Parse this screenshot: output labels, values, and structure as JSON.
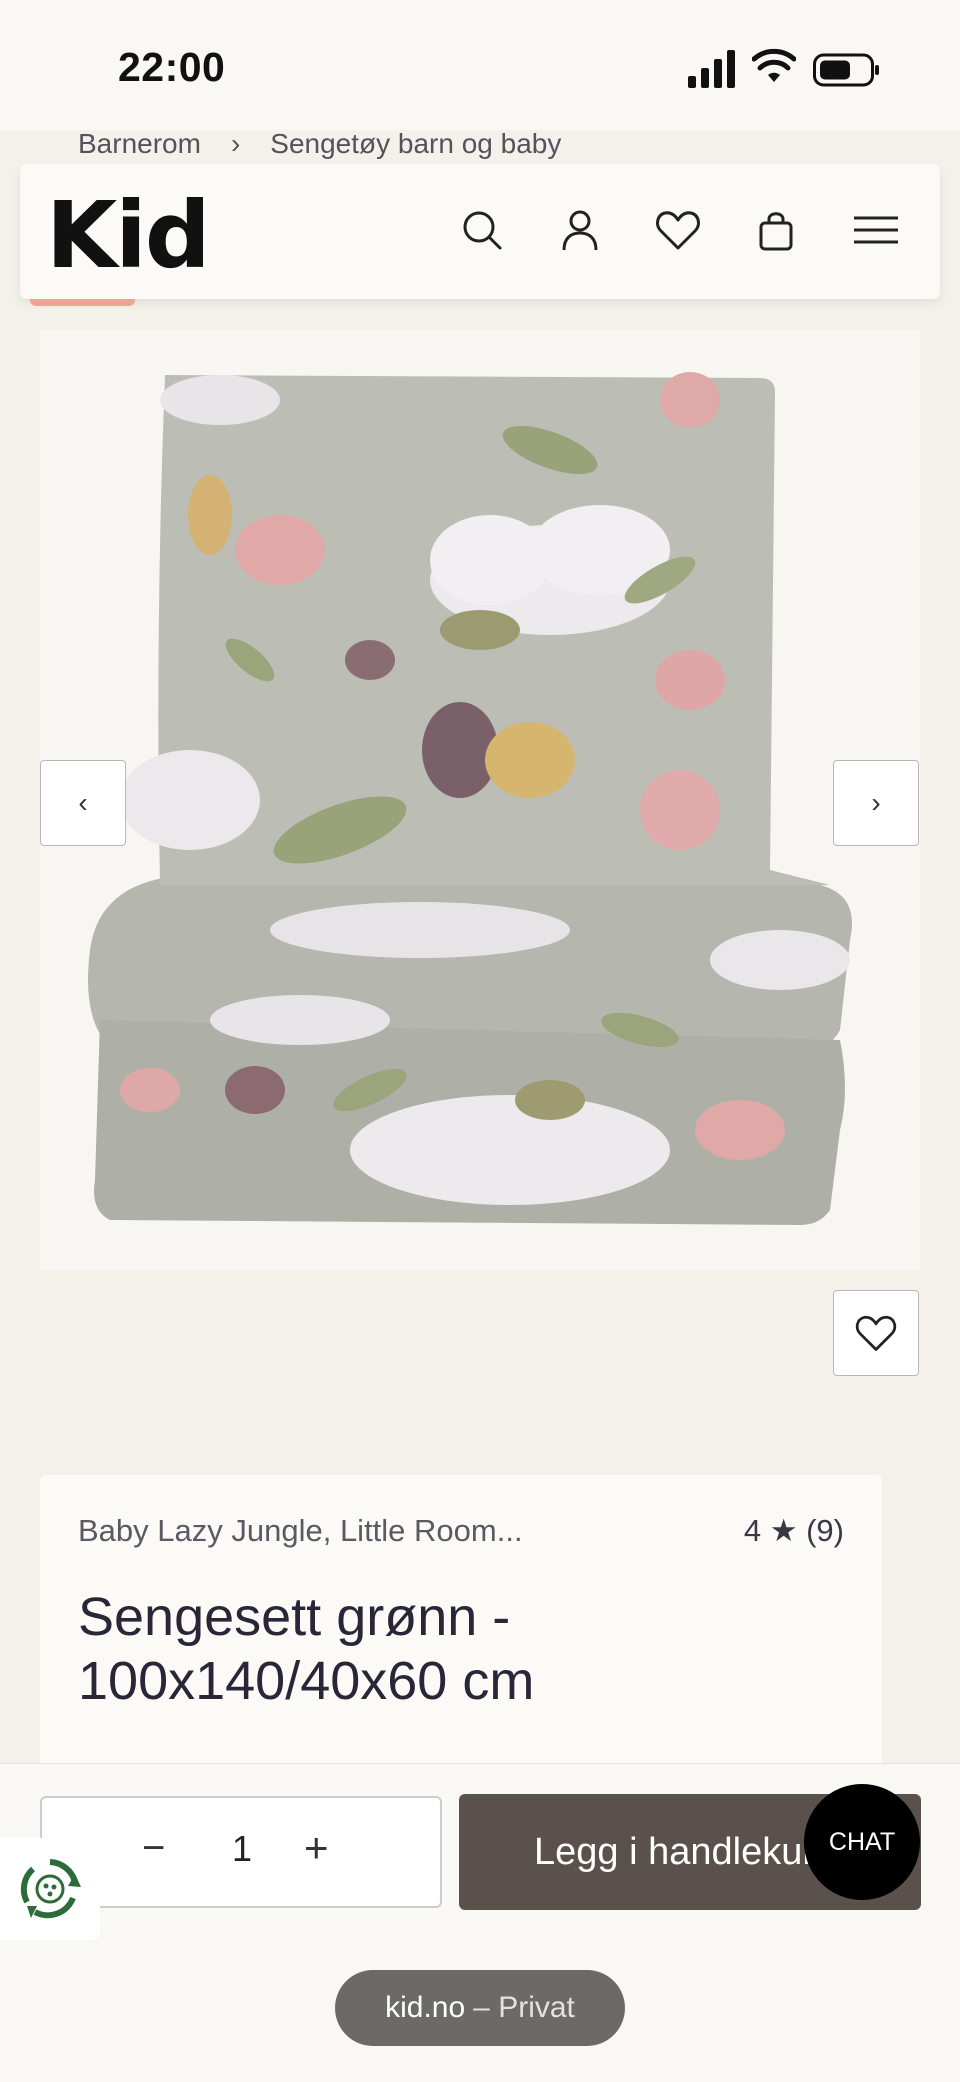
{
  "status": {
    "time": "22:00"
  },
  "breadcrumb": {
    "items": [
      "Barnerom",
      "Sengetøy barn og baby"
    ],
    "separator": "›"
  },
  "header": {
    "logo": "Kid",
    "icons": [
      "search-icon",
      "account-icon",
      "wishlist-icon",
      "cart-icon",
      "menu-icon"
    ]
  },
  "gallery": {
    "prev": "‹",
    "next": "›"
  },
  "product": {
    "brand": "Baby Lazy Jungle, Little Room...",
    "rating": "4 ★ (9)",
    "title": "Sengesett grønn - 100x140/40x60 cm"
  },
  "purchase": {
    "qty_minus": "−",
    "quantity": "1",
    "qty_plus": "+",
    "add_to_cart": "Legg i handlekurv"
  },
  "chat": {
    "label": "CHAT"
  },
  "browser": {
    "domain": "kid.no",
    "mode": "– Privat"
  },
  "colors": {
    "accent_dark": "#5a514c",
    "background": "#f4f1ea",
    "pink": "#f2a294"
  }
}
